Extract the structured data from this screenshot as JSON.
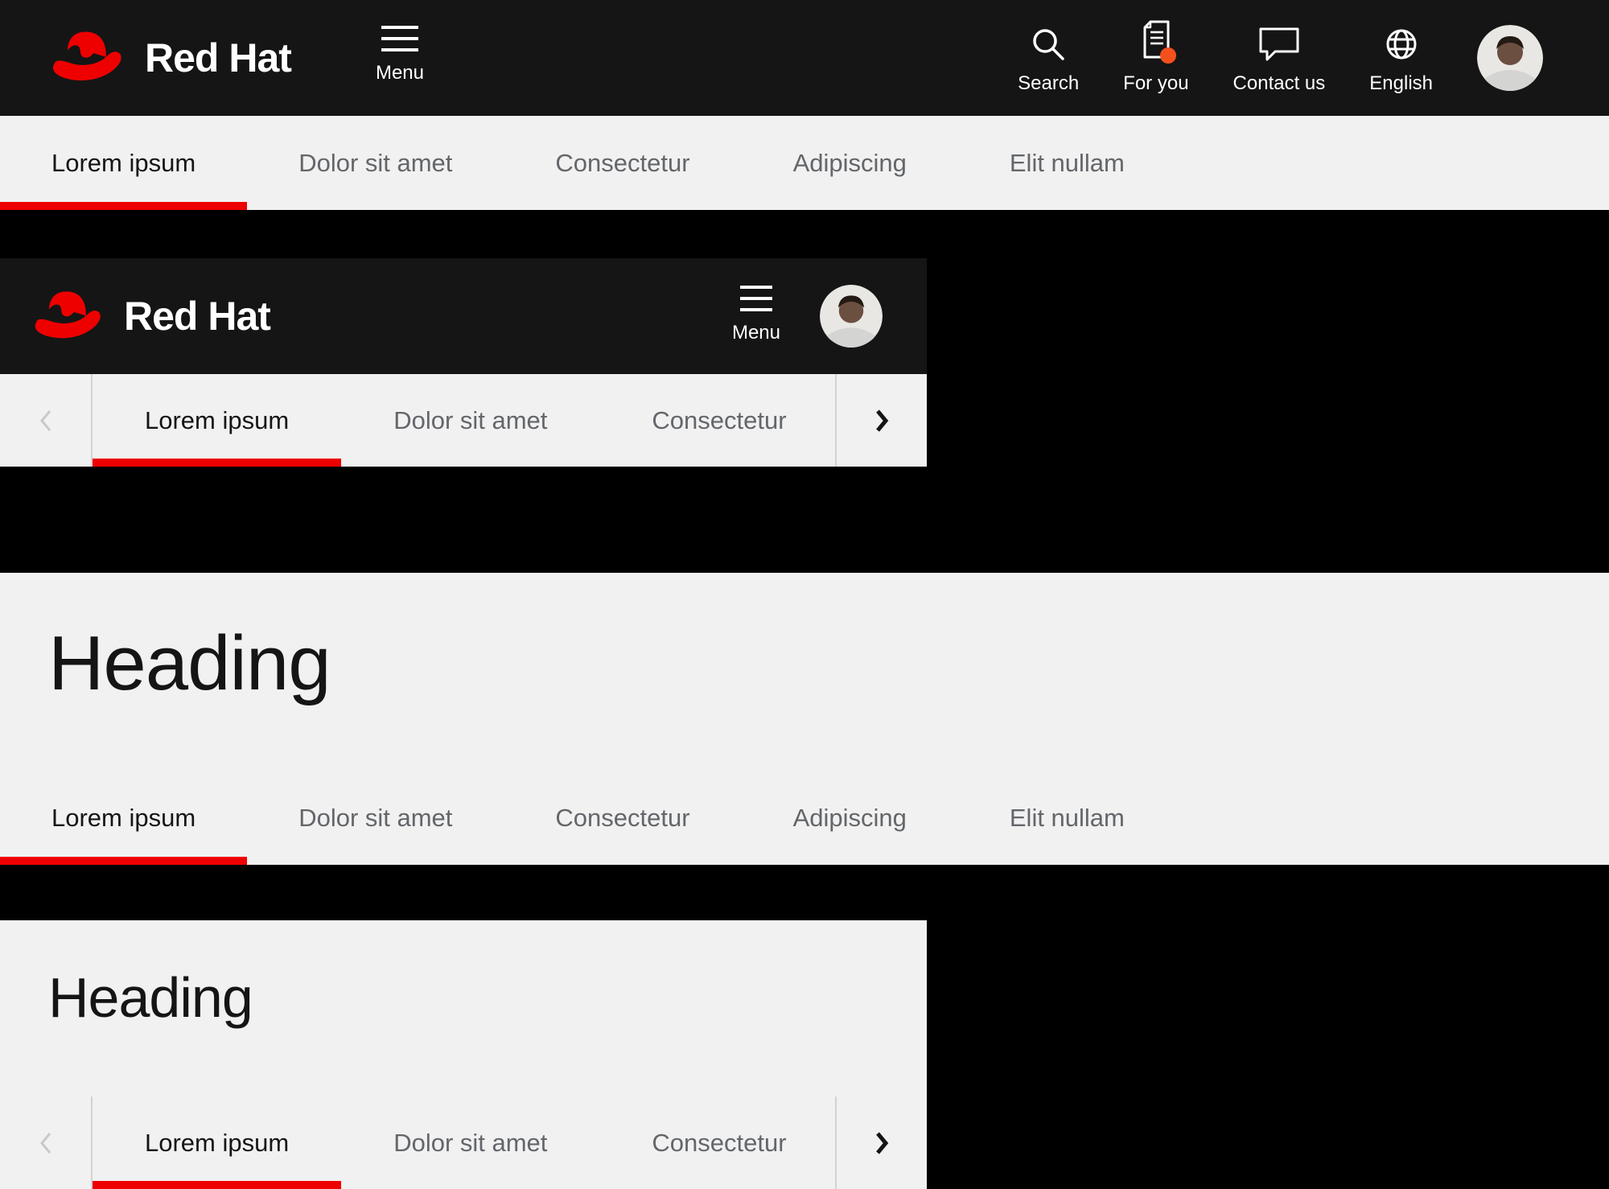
{
  "brand": {
    "name": "Red Hat",
    "logo_alt": "Red Hat fedora logo"
  },
  "colors": {
    "masthead_bg": "#151515",
    "page_bg": "#000000",
    "surface": "#f1f1f1",
    "accent_red": "#ee0000",
    "notification_dot": "#f4501e",
    "tab_inactive": "#63666a",
    "tab_active": "#151515",
    "divider": "#d2d2d2",
    "chevron_disabled": "#c9c9c9",
    "text_on_dark": "#ffffff"
  },
  "desktop_header": {
    "menu_label": "Menu",
    "utilities": [
      {
        "label": "Search",
        "icon": "search-icon"
      },
      {
        "label": "For you",
        "icon": "document-icon",
        "has_notification": true
      },
      {
        "label": "Contact us",
        "icon": "chat-bubble-icon"
      },
      {
        "label": "English",
        "icon": "globe-icon"
      }
    ],
    "avatar_alt": "user avatar"
  },
  "mobile_header": {
    "menu_label": "Menu",
    "avatar_alt": "user avatar"
  },
  "tabs_desktop": {
    "items": [
      {
        "label": "Lorem ipsum",
        "active": true
      },
      {
        "label": "Dolor sit amet",
        "active": false
      },
      {
        "label": "Consectetur",
        "active": false
      },
      {
        "label": "Adipiscing",
        "active": false
      },
      {
        "label": "Elit nullam",
        "active": false
      }
    ]
  },
  "tabs_mobile": {
    "scroll_left_icon": "chevron-left-icon",
    "scroll_right_icon": "chevron-right-icon",
    "items": [
      {
        "label": "Lorem ipsum",
        "active": true
      },
      {
        "label": "Dolor sit amet",
        "active": false
      },
      {
        "label": "Consectetur",
        "active": false
      }
    ]
  },
  "sections": {
    "desktop": {
      "heading": "Heading"
    },
    "mobile": {
      "heading": "Heading"
    }
  }
}
